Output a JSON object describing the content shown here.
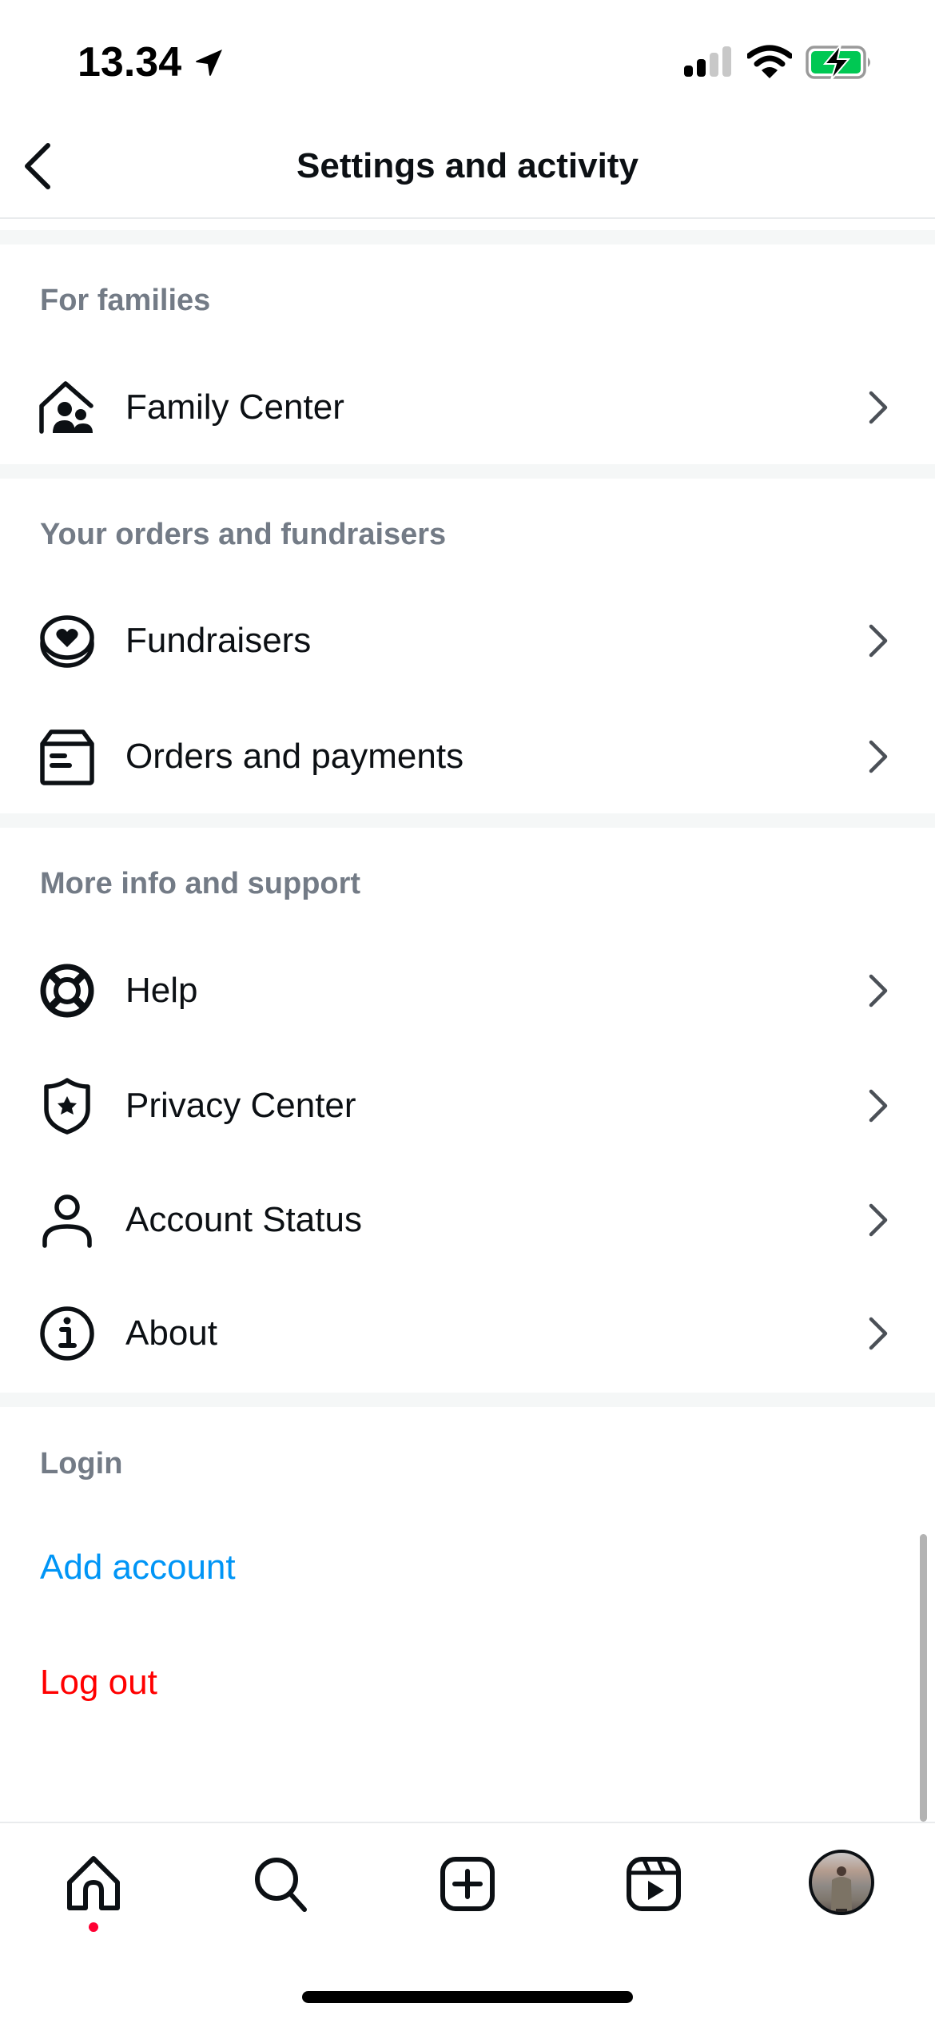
{
  "status_bar": {
    "time": "13.34",
    "location_icon": "location-arrow-icon",
    "signal_bars_active": 2,
    "signal_bars_total": 4,
    "wifi_icon": "wifi-icon",
    "battery_icon": "battery-charging-icon",
    "battery_color": "#00c853"
  },
  "header": {
    "back_icon": "chevron-left-icon",
    "title": "Settings and activity"
  },
  "sections": [
    {
      "header": "For families",
      "items": [
        {
          "label": "Family Center",
          "icon": "family-center-icon"
        }
      ]
    },
    {
      "header": "Your orders and fundraisers",
      "items": [
        {
          "label": "Fundraisers",
          "icon": "fundraiser-icon"
        },
        {
          "label": "Orders and payments",
          "icon": "orders-box-icon"
        }
      ]
    },
    {
      "header": "More info and support",
      "items": [
        {
          "label": "Help",
          "icon": "lifebuoy-icon"
        },
        {
          "label": "Privacy Center",
          "icon": "shield-star-icon"
        },
        {
          "label": "Account Status",
          "icon": "person-icon"
        },
        {
          "label": "About",
          "icon": "info-icon"
        }
      ]
    },
    {
      "header": "Login",
      "links": [
        {
          "label": "Add account",
          "color": "#0095f6"
        },
        {
          "label": "Log out",
          "color": "#ff0000"
        }
      ]
    }
  ],
  "tab_bar": {
    "tabs": [
      {
        "name": "Home",
        "icon": "home-icon",
        "has_notification": true
      },
      {
        "name": "Search",
        "icon": "search-icon"
      },
      {
        "name": "Create",
        "icon": "plus-square-icon"
      },
      {
        "name": "Reels",
        "icon": "reels-icon"
      },
      {
        "name": "Profile",
        "icon": "avatar"
      }
    ],
    "notification_dot_color": "#ff0033"
  },
  "colors": {
    "section_header": "#737b86",
    "separator": "#f5f7f7",
    "chevron": "#4b5057",
    "text": "#0c1014"
  }
}
